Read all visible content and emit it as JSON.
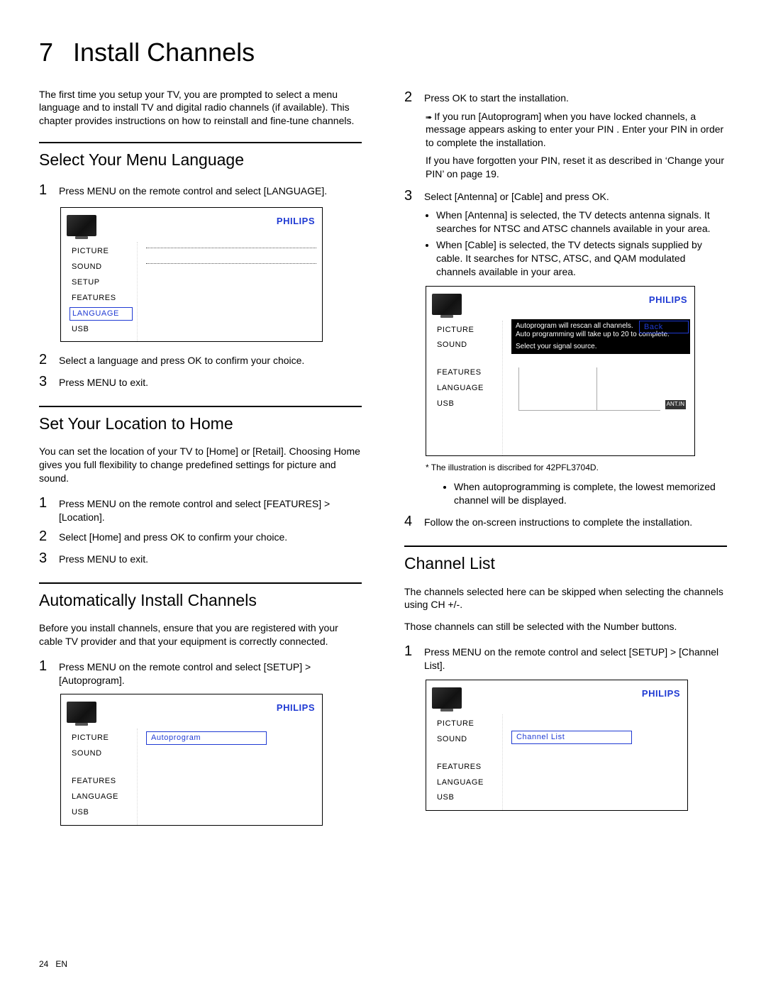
{
  "chapter": {
    "number": "7",
    "title": "Install Channels"
  },
  "intro": "The ﬁrst time you setup your TV, you are prompted to select a menu language and to install TV and digital radio channels (if available). This chapter provides instructions on how to reinstall and ﬁne-tune channels.",
  "brand": "PHILIPS",
  "osd_menu": {
    "picture": "PICTURE",
    "sound": "SOUND",
    "setup": "SETUP",
    "features": "FEATURES",
    "language": "LANGUAGE",
    "usb": "USB"
  },
  "section_language": {
    "heading": "Select Your Menu Language",
    "step1": "Press MENU on the remote control and select [LANGUAGE].",
    "step2": "Select a language and press OK to conﬁrm your choice.",
    "step3": "Press MENU to exit."
  },
  "section_location": {
    "heading": "Set Your Location to Home",
    "intro": "You can set the location of your TV to [Home] or [Retail]. Choosing Home gives you full ﬂexibility to change predeﬁned settings for picture and sound.",
    "step1": "Press MENU on the remote control and select [FEATURES] > [Location].",
    "step2": "Select [Home] and press OK to conﬁrm your choice.",
    "step3": "Press MENU to exit."
  },
  "section_auto": {
    "heading": "Automatically Install Channels",
    "intro": "Before you install channels, ensure that you are registered with your cable TV provider and that your equipment is correctly connected.",
    "step1": "Press MENU on the remote control and select [SETUP] > [Autoprogram].",
    "autoprogram_label": "Autoprogram"
  },
  "right_col": {
    "step2": "Press OK to start the installation.",
    "step2_arrow": "If you run [Autoprogram] when you have locked channels, a message appears asking to enter your PIN . Enter your PIN in order to complete the installation.",
    "step2_note": "If you have forgotten your PIN, reset it as described in ‘Change your PIN’ on page 19.",
    "step3": "Select [Antenna] or [Cable] and press OK.",
    "step3_bullet_a": "When [Antenna] is selected, the TV detects antenna signals. It searches for NTSC and ATSC channels available in your area.",
    "step3_bullet_b": "When [Cable] is selected, the TV detects signals supplied by cable. It searches for NTSC, ATSC, and QAM modulated channels available in your area.",
    "signal_box_line1": "Autoprogram will rescan all channels.",
    "signal_box_line2": "Auto programming will take up to 20 to complete.",
    "signal_box_line3": "Select your signal source.",
    "back_label": "Back",
    "antin_label": "ANT.IN",
    "caption": "* The illustration is discribed for 42PFL3704D.",
    "bullet_after_diagram": "When autoprogramming is complete, the lowest memorized channel will be displayed.",
    "step4": "Follow the on-screen instructions to complete the installation."
  },
  "section_channel_list": {
    "heading": "Channel List",
    "intro1": "The channels selected here can be skipped when selecting the channels using CH +/-.",
    "intro2": "Those channels can still be selected with the Number buttons.",
    "step1": "Press MENU on the remote control and select [SETUP] > [Channel List].",
    "channel_list_label": "Channel List"
  },
  "footer": {
    "page": "24",
    "lang": "EN"
  }
}
